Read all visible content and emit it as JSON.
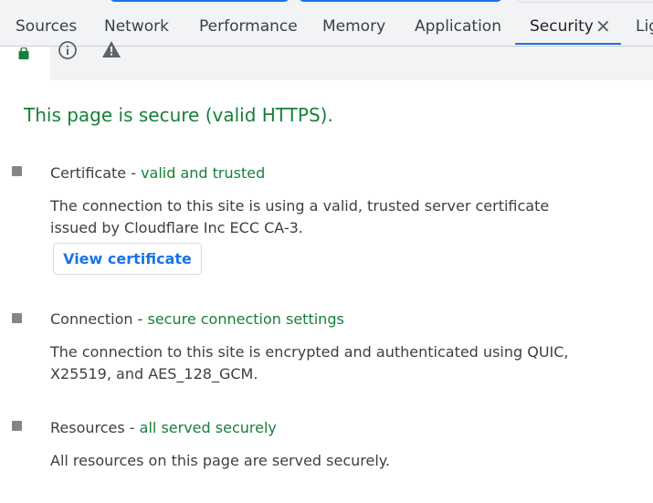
{
  "tabs": [
    {
      "label": "Sources"
    },
    {
      "label": "Network"
    },
    {
      "label": "Performance"
    },
    {
      "label": "Memory"
    },
    {
      "label": "Application"
    },
    {
      "label": "Security"
    },
    {
      "label": "Lig"
    }
  ],
  "active_tab": "Security",
  "subbar_icons": [
    "lock-icon",
    "info-icon",
    "warning-icon"
  ],
  "headline": "This page is secure (valid HTTPS).",
  "sections": [
    {
      "title": "Certificate",
      "separator": " - ",
      "status": "valid and trusted",
      "description": "The connection to this site is using a valid, trusted server certificate issued by Cloudflare Inc ECC CA-3.",
      "button_label": "View certificate"
    },
    {
      "title": "Connection",
      "separator": " - ",
      "status": "secure connection settings",
      "description": "The connection to this site is encrypted and authenticated using QUIC, X25519, and AES_128_GCM."
    },
    {
      "title": "Resources",
      "separator": " - ",
      "status": "all served securely",
      "description": "All resources on this page are served securely."
    }
  ],
  "colors": {
    "secure_green": "#188038",
    "accent_blue": "#1a73e8",
    "bullet_gray": "#80868b"
  }
}
